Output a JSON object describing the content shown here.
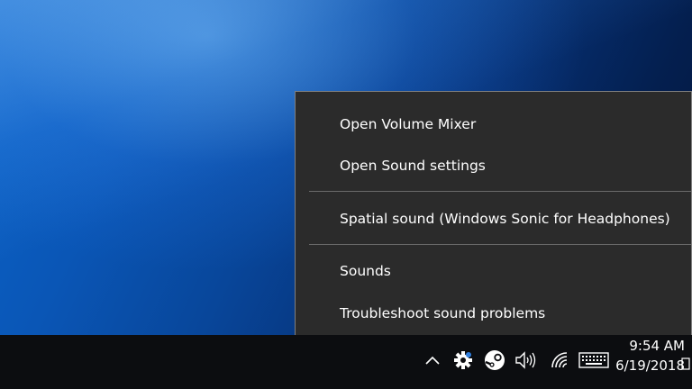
{
  "context_menu": {
    "items": [
      {
        "label": "Open Volume Mixer"
      },
      {
        "label": "Open Sound settings"
      },
      {
        "label": "Spatial sound (Windows Sonic for Headphones)"
      },
      {
        "label": "Sounds"
      },
      {
        "label": "Troubleshoot sound problems"
      }
    ]
  },
  "taskbar": {
    "tray_icons": [
      {
        "name": "chevron-up-icon"
      },
      {
        "name": "gear-icon"
      },
      {
        "name": "steam-icon"
      },
      {
        "name": "speaker-icon"
      },
      {
        "name": "wifi-icon"
      },
      {
        "name": "keyboard-icon"
      }
    ],
    "clock": {
      "time": "9:54 AM",
      "date": "6/19/2018"
    }
  },
  "colors": {
    "menu_background": "#2b2b2b",
    "menu_border": "#808080",
    "taskbar": "#0c0d10",
    "desktop_accent": "#0b63c9"
  }
}
